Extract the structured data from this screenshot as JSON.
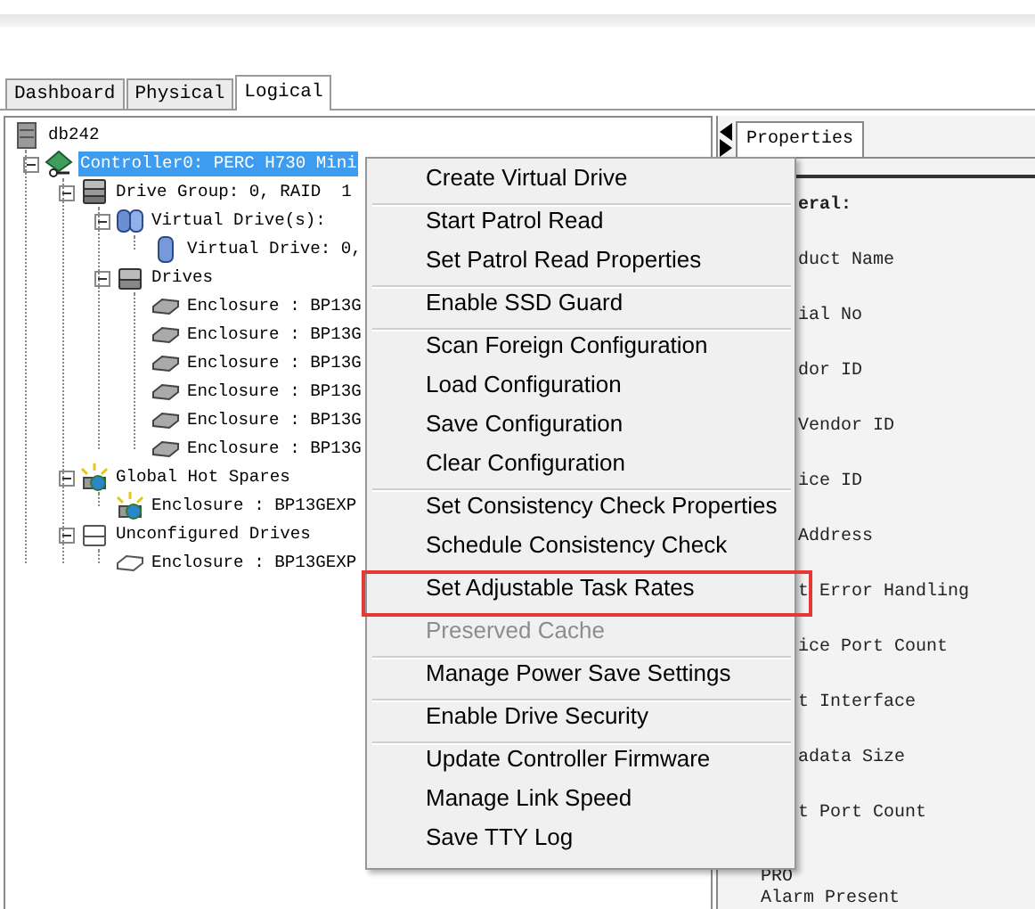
{
  "tabs": [
    {
      "label": "Dashboard",
      "selected": false
    },
    {
      "label": "Physical",
      "selected": false
    },
    {
      "label": "Logical",
      "selected": true
    }
  ],
  "tree": [
    {
      "label": "db242",
      "kind": "server",
      "selected": false,
      "children": [
        {
          "label": "Controller0: PERC H730 Mini",
          "kind": "controller",
          "selected": true,
          "expanded": true,
          "children": [
            {
              "label": "Drive Group: 0, RAID  1",
              "kind": "drive-group",
              "selected": false,
              "expanded": true,
              "children": [
                {
                  "label": "Virtual Drive(s):",
                  "kind": "virtual-drives",
                  "selected": false,
                  "expanded": true,
                  "children": [
                    {
                      "label": "Virtual Drive: 0,",
                      "kind": "virtual-drive",
                      "selected": false
                    }
                  ]
                },
                {
                  "label": "Drives",
                  "kind": "drives",
                  "selected": false,
                  "expanded": true,
                  "children": [
                    {
                      "label": "Enclosure : BP13G",
                      "kind": "disk",
                      "selected": false
                    },
                    {
                      "label": "Enclosure : BP13G",
                      "kind": "disk",
                      "selected": false
                    },
                    {
                      "label": "Enclosure : BP13G",
                      "kind": "disk",
                      "selected": false
                    },
                    {
                      "label": "Enclosure : BP13G",
                      "kind": "disk",
                      "selected": false
                    },
                    {
                      "label": "Enclosure : BP13G",
                      "kind": "disk",
                      "selected": false
                    },
                    {
                      "label": "Enclosure : BP13G",
                      "kind": "disk",
                      "selected": false
                    }
                  ]
                }
              ]
            },
            {
              "label": "Global Hot Spares",
              "kind": "hot-spares",
              "selected": false,
              "expanded": true,
              "children": [
                {
                  "label": "Enclosure : BP13GEXP",
                  "kind": "hot-spare-disk",
                  "selected": false
                }
              ]
            },
            {
              "label": "Unconfigured Drives",
              "kind": "unconfigured",
              "selected": false,
              "expanded": true,
              "children": [
                {
                  "label": "Enclosure : BP13GEXP",
                  "kind": "unconfigured-disk",
                  "selected": false
                }
              ]
            }
          ]
        }
      ]
    }
  ],
  "properties_panel": {
    "tab": {
      "label": "Properties",
      "selected": true
    },
    "heading": "eral:",
    "labels": [
      "duct Name",
      "ial No",
      "dor ID",
      "Vendor ID",
      "ice ID",
      "Address",
      "t Error Handling",
      "ice Port Count",
      "t Interface",
      "adata Size",
      "t Port Count"
    ],
    "footer_labels": [
      "PRO",
      "Alarm Present"
    ]
  },
  "context_menu": {
    "groups": [
      [
        {
          "label": "Create Virtual Drive",
          "disabled": false,
          "annotated": false
        }
      ],
      [
        {
          "label": "Start Patrol Read",
          "disabled": false,
          "annotated": false
        },
        {
          "label": "Set Patrol Read Properties",
          "disabled": false,
          "annotated": false
        }
      ],
      [
        {
          "label": "Enable SSD Guard",
          "disabled": false,
          "annotated": false
        }
      ],
      [
        {
          "label": "Scan Foreign Configuration",
          "disabled": false,
          "annotated": false
        },
        {
          "label": "Load Configuration",
          "disabled": false,
          "annotated": false
        },
        {
          "label": "Save Configuration",
          "disabled": false,
          "annotated": false
        },
        {
          "label": "Clear Configuration",
          "disabled": false,
          "annotated": false
        }
      ],
      [
        {
          "label": "Set Consistency Check Properties",
          "disabled": false,
          "annotated": false
        },
        {
          "label": "Schedule Consistency Check",
          "disabled": false,
          "annotated": false
        }
      ],
      [
        {
          "label": "Set Adjustable Task Rates",
          "disabled": false,
          "annotated": true
        }
      ],
      [
        {
          "label": "Preserved Cache",
          "disabled": true,
          "annotated": false
        }
      ],
      [
        {
          "label": "Manage Power Save Settings",
          "disabled": false,
          "annotated": false
        }
      ],
      [
        {
          "label": "Enable Drive Security",
          "disabled": false,
          "annotated": false
        }
      ],
      [
        {
          "label": "Update Controller Firmware",
          "disabled": false,
          "annotated": false
        },
        {
          "label": "Manage Link Speed",
          "disabled": false,
          "annotated": false
        },
        {
          "label": "Save TTY Log",
          "disabled": false,
          "annotated": false
        }
      ]
    ]
  }
}
